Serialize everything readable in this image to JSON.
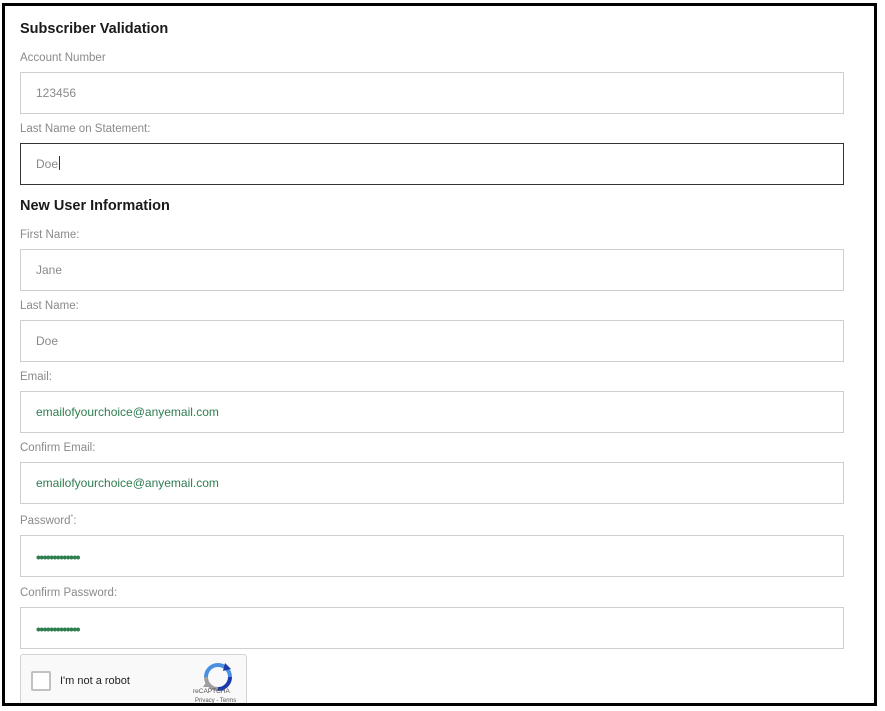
{
  "subscriber_validation": {
    "title": "Subscriber Validation",
    "account_number": {
      "label": "Account Number",
      "value": "123456"
    },
    "last_name_on_statement": {
      "label": "Last Name on Statement:",
      "value": "Doe"
    }
  },
  "new_user_information": {
    "title": "New User Information",
    "first_name": {
      "label": "First Name:",
      "value": "Jane"
    },
    "last_name": {
      "label": "Last Name:",
      "value": "Doe"
    },
    "email": {
      "label": "Email:",
      "value": "emailofyourchoice@anyemail.com"
    },
    "confirm_email": {
      "label": "Confirm Email:",
      "value": "emailofyourchoice@anyemail.com"
    },
    "password": {
      "label": "Password",
      "required_mark": "*",
      "label_suffix": ":",
      "masked_value": "•••••••••••••"
    },
    "confirm_password": {
      "label": "Confirm Password:",
      "masked_value": "•••••••••••••"
    }
  },
  "captcha": {
    "checkbox_label": "I'm not a robot",
    "brand": "reCAPTCHA",
    "links": "Privacy - Terms",
    "icon": "recaptcha-logo-icon"
  },
  "colors": {
    "border": "#000000",
    "field_border": "#cfcfcf",
    "focused_border": "#333333",
    "label_text": "#8a8a8a",
    "filled_email_text": "#2e7d4f"
  }
}
